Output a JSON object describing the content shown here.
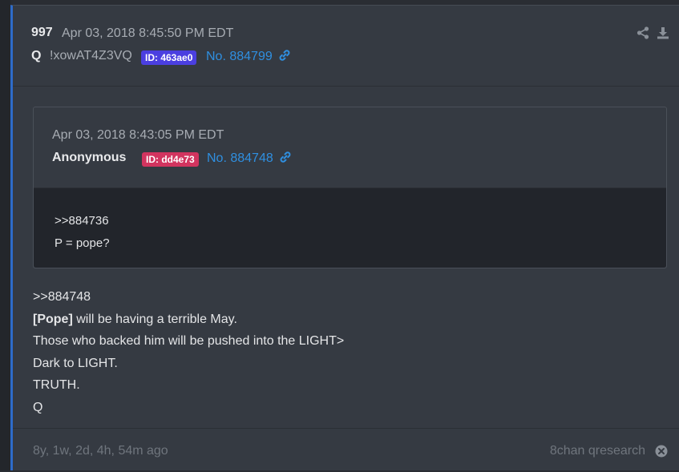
{
  "post": {
    "number": "997",
    "date": "Apr 03, 2018 8:45:50 PM EDT",
    "author": "Q",
    "tripcode": "!xowAT4Z3VQ",
    "id_badge": "ID: 463ae0",
    "post_link": "No. 884799",
    "icons": [
      "share-icon",
      "download-icon",
      "link-icon"
    ]
  },
  "quoted": {
    "date": "Apr 03, 2018 8:43:05 PM EDT",
    "author": "Anonymous",
    "id_badge": "ID: dd4e73",
    "post_link": "No. 884748",
    "lines": [
      ">>884736",
      "P = pope?"
    ]
  },
  "body": {
    "reply_ref": ">>884748",
    "line1_bold": "[Pope]",
    "line1_rest": " will be having a terrible May.",
    "line2": "Those who backed him will be pushed into the LIGHT>",
    "line3": "Dark to LIGHT.",
    "line4": "TRUTH.",
    "line5": "Q"
  },
  "footer": {
    "ago": "8y, 1w, 2d, 4h, 54m ago",
    "source": "8chan qresearch"
  },
  "colors": {
    "accent_border": "#2e6bc9",
    "id_blue": "#4b3fe0",
    "id_red": "#d2345f",
    "link": "#2f8fe0"
  }
}
